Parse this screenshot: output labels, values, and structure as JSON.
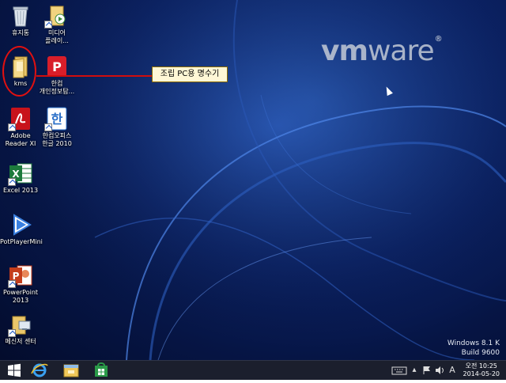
{
  "brand": {
    "vm": "vm",
    "ware": "ware",
    "mark": "®"
  },
  "icons": {
    "recycle": "휴지통",
    "media_line1": "미디어",
    "media_line2": "플레이...",
    "kms": "kms",
    "hancom_line1": "한컴",
    "hancom_line2": "개인정보탐...",
    "adobe_line1": "Adobe",
    "adobe_line2": "Reader XI",
    "hoffice_line1": "한컴오피스",
    "hoffice_line2": "한글 2010",
    "excel": "Excel 2013",
    "potplayer": "PotPlayerMini",
    "ppt_line1": "PowerPoint",
    "ppt_line2": "2013",
    "messenger": "메신저 센터"
  },
  "callout": {
    "text": "조립 PC용 명수기"
  },
  "watermark": {
    "line1": "Windows 8.1 K",
    "line2": "Build 9600"
  },
  "taskbar": {
    "time": "오전 10:25",
    "date": "2014-05-20",
    "ime": "A"
  },
  "colors": {
    "annotation": "#e01010",
    "taskbar": "#1b1f2d"
  }
}
